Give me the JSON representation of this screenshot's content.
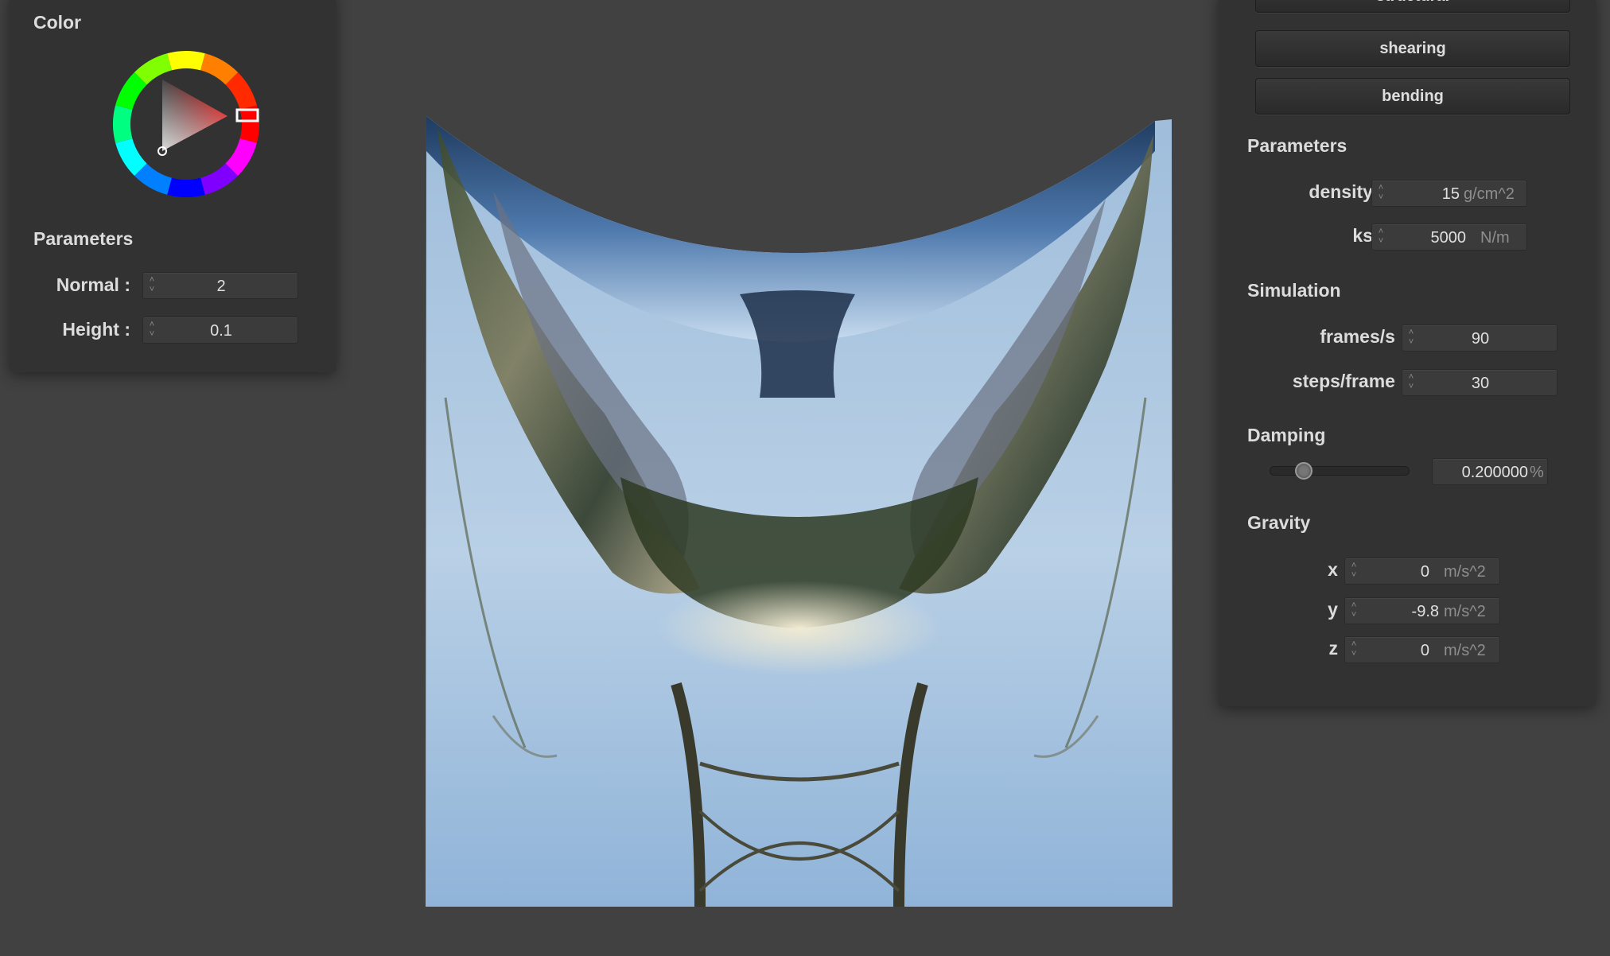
{
  "left_panel": {
    "color_title": "Color",
    "parameters_title": "Parameters",
    "normal_label": "Normal :",
    "normal_value": "2",
    "height_label": "Height :",
    "height_value": "0.1",
    "color_wheel_hue": "#e02020"
  },
  "right_panel": {
    "springs": [
      "structural",
      "shearing",
      "bending"
    ],
    "parameters_title": "Parameters",
    "density_label": "density :",
    "density_value": "15",
    "density_unit": "g/cm^2",
    "ks_label": "ks :",
    "ks_value": "5000",
    "ks_unit": "N/m",
    "simulation_title": "Simulation",
    "fps_label": "frames/s :",
    "fps_value": "90",
    "steps_label": "steps/frame :",
    "steps_value": "30",
    "damping_title": "Damping",
    "damping_value": "0.200000",
    "damping_unit": "%",
    "damping_slider_fraction": 0.2,
    "gravity_title": "Gravity",
    "gx_label": "x :",
    "gx_value": "0",
    "gy_label": "y :",
    "gy_value": "-9.8",
    "gz_label": "z :",
    "gz_value": "0",
    "gravity_unit": "m/s^2"
  }
}
